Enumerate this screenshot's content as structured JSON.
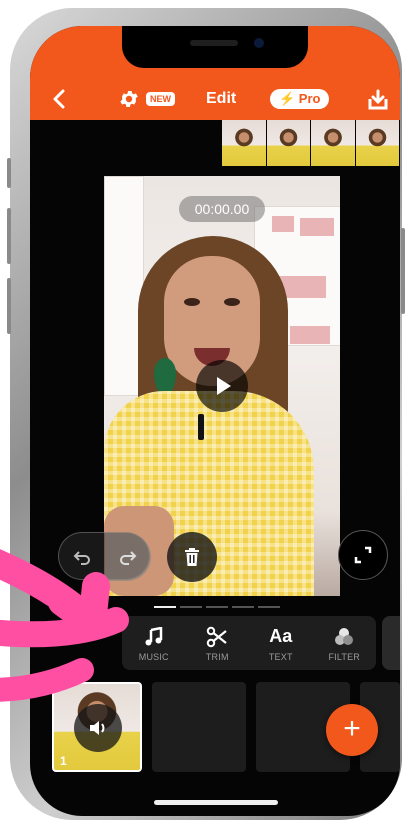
{
  "header": {
    "new_badge": "NEW",
    "title": "Edit",
    "pro_badge": "⚡ Pro"
  },
  "preview": {
    "timecode": "00:00.00"
  },
  "tools": [
    {
      "label": "MUSIC",
      "icon": "music-note-icon"
    },
    {
      "label": "TRIM",
      "icon": "scissors-icon"
    },
    {
      "label": "TEXT",
      "icon": "text-aa-icon"
    },
    {
      "label": "FILTER",
      "icon": "filter-circles-icon"
    }
  ],
  "text_icon_glyph": "Aa",
  "timeline": {
    "clip_number": "1",
    "add_label": "+"
  },
  "colors": {
    "accent": "#f2571b",
    "annotation": "#ff4fa3"
  }
}
